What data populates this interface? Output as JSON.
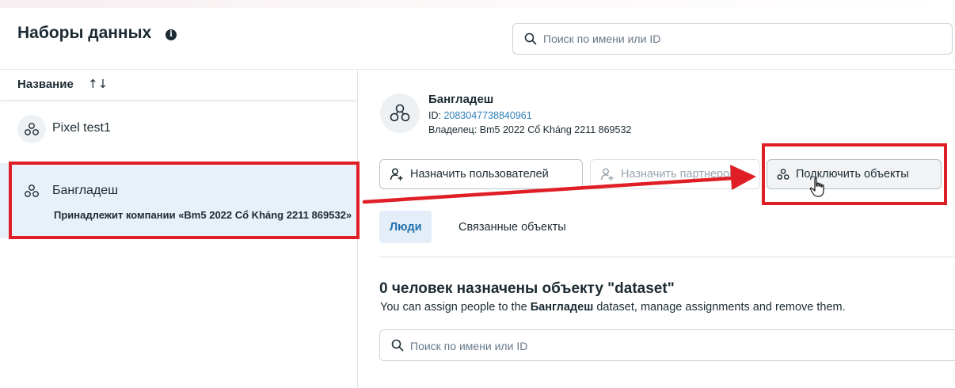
{
  "header": {
    "title": "Наборы данных",
    "info_icon": "info-icon",
    "search_placeholder": "Поиск по имени или ID"
  },
  "list": {
    "column_header": "Название",
    "sort_icon": "↑↓",
    "items": [
      {
        "name": "Pixel test1",
        "icon": "dataset-icon"
      },
      {
        "name": "Бангладеш",
        "owner": "Принадлежит компании «Bm5 2022 Cổ Kháng 2211 869532»",
        "icon": "dataset-icon",
        "selected": true
      }
    ]
  },
  "detail": {
    "name": "Бангладеш",
    "id_label": "ID: ",
    "id_value": "2083047738840961",
    "owner": "Владелец: Bm5 2022 Cổ Kháng 2211 869532",
    "buttons": {
      "assign_users": "Назначить пользователей",
      "assign_partners": "Назначить партнеров",
      "connect_objects": "Подключить объекты"
    },
    "tabs": {
      "people": "Люди",
      "related": "Связанные объекты"
    },
    "section_title": "0 человек назначены объекту \"dataset\"",
    "section_desc_pre": "You can assign people to the ",
    "section_desc_bold": "Бангладеш",
    "section_desc_post": " dataset, manage assignments and remove them.",
    "search_placeholder": "Поиск по имени или ID"
  },
  "colors": {
    "annotation_red": "#e01e26",
    "selected_row": "#e8f0fa",
    "link_blue": "#2e7fb8",
    "tab_active_bg": "#e3eef8"
  }
}
